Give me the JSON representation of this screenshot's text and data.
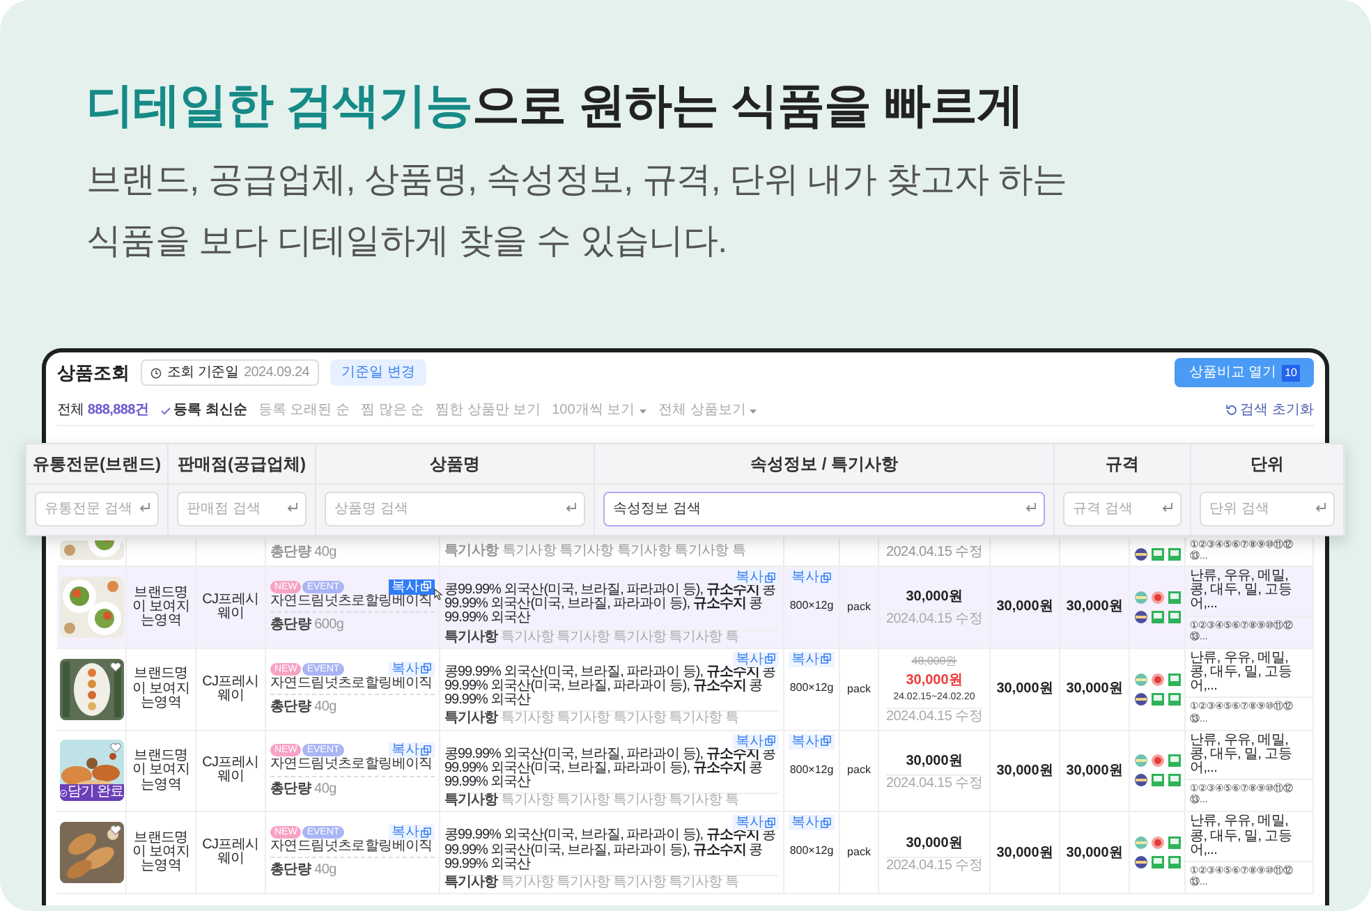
{
  "headline": {
    "highlight": "디테일한 검색기능",
    "rest": "으로 원하는 식품을 빠르게"
  },
  "subtitle": [
    "브랜드, 공급업체, 상품명, 속성정보, 규격, 단위 내가 찾고자 하는",
    "식품을 보다 디테일하게 찾을 수 있습니다."
  ],
  "app": {
    "title": "상품조회",
    "date_label": "조회 기준일",
    "date": "2024.09.24",
    "date_button": "기준일 변경",
    "compare_button": "상품비교 열기",
    "compare_count": "10",
    "total_label": "전체",
    "total": "888,888건",
    "sort_options": [
      {
        "label": "등록 최신순",
        "selected": true
      },
      {
        "label": "등록 오래된 순",
        "selected": false
      },
      {
        "label": "찜 많은 순",
        "selected": false
      },
      {
        "label": "찜한 상품만 보기",
        "selected": false
      }
    ],
    "dropdowns": [
      "100개씩 보기",
      "전체 상품보기"
    ],
    "reset": "검색 초기화"
  },
  "search_panel": [
    {
      "heading": "유통전문(브랜드)",
      "placeholder": "유통전문 검색",
      "focused": false
    },
    {
      "heading": "판매점(공급업체)",
      "placeholder": "판매점 검색",
      "focused": false
    },
    {
      "heading": "상품명",
      "placeholder": "상품명 검색",
      "focused": false
    },
    {
      "heading": "속성정보 / 특기사항",
      "value": "속성정보 검색",
      "focused": true
    },
    {
      "heading": "규격",
      "placeholder": "규격 검색",
      "focused": false
    },
    {
      "heading": "단위",
      "placeholder": "단위 검색",
      "focused": false
    }
  ],
  "partial_row": {
    "weight_label": "총단량",
    "weight": "40g",
    "notes_label": "특기사항",
    "notes": "특기사항 특기사항 특기사항 특기사항 특",
    "updated": "2024.04.15 수정",
    "allergen_codes": "①②③④⑤⑥⑦⑧⑨⑩⑪⑫⑬..."
  },
  "rows": [
    {
      "selected": true,
      "heart": false,
      "brand": "브랜드명이 보여지는영역",
      "seller": "CJ프레시웨이",
      "tags": [
        {
          "label": "NEW",
          "color": "#f7a3c4"
        },
        {
          "label": "EVENT",
          "color": "#a9b5f4"
        }
      ],
      "name": "자연드림넛츠로할링베이직",
      "name_copy": {
        "label": "복사",
        "active": true
      },
      "weight_label": "총단량",
      "weight": "600g",
      "attr_copy": {
        "label": "복사",
        "active": false
      },
      "attributes": "콩99.99% 외국산(미국, 브라질, 파라과이 등), **규소수지** 콩99.99% 외국산(미국, 브라질, 파라과이 등), **규소수지** 콩99.99% 외국산",
      "notes_label": "특기사항",
      "notes": "특기사항 특기사항 특기사항 특기사항 특",
      "spec_copy": {
        "label": "복사",
        "active": false
      },
      "spec": "800×12g",
      "unit": "pack",
      "price": "30,000원",
      "updated": "2024.04.15 수정",
      "price_2": "30,000원",
      "price_3": "30,000원",
      "allergens": "난류, 우유, 메밀, 콩, 대두, 밀, 고등어,...",
      "allergen_codes": "①②③④⑤⑥⑦⑧⑨⑩⑪⑫⑬..."
    },
    {
      "selected": false,
      "heart": true,
      "brand": "브랜드명이 보여지는영역",
      "seller": "CJ프레시웨이",
      "tags": [
        {
          "label": "NEW",
          "color": "#f7a3c4"
        },
        {
          "label": "EVENT",
          "color": "#a9b5f4"
        }
      ],
      "name": "자연드림넛츠로할링베이직",
      "name_copy": {
        "label": "복사",
        "active": false
      },
      "weight_label": "총단량",
      "weight": "40g",
      "attr_copy": {
        "label": "복사",
        "active": false
      },
      "attributes": "콩99.99% 외국산(미국, 브라질, 파라과이 등), **규소수지** 콩99.99% 외국산(미국, 브라질, 파라과이 등), **규소수지** 콩99.99% 외국산",
      "notes_label": "특기사항",
      "notes": "특기사항 특기사항 특기사항 특기사항 특",
      "spec_copy": {
        "label": "복사",
        "active": false
      },
      "spec": "800×12g",
      "unit": "pack",
      "original_price": "48,000원",
      "price": "30,000원",
      "sale_period": "24.02.15~24.02.20",
      "updated": "2024.04.15 수정",
      "price_2": "30,000원",
      "price_3": "30,000원",
      "allergens": "난류, 우유, 메밀, 콩, 대두, 밀, 고등어,...",
      "allergen_codes": "①②③④⑤⑥⑦⑧⑨⑩⑪⑫⑬..."
    },
    {
      "selected": false,
      "heart": true,
      "cart_label": "담기 완료",
      "brand": "브랜드명이 보여지는영역",
      "seller": "CJ프레시웨이",
      "tags": [
        {
          "label": "NEW",
          "color": "#f7a3c4"
        },
        {
          "label": "EVENT",
          "color": "#a9b5f4"
        }
      ],
      "name": "자연드림넛츠로할링베이직",
      "name_copy": {
        "label": "복사",
        "active": false
      },
      "weight_label": "총단량",
      "weight": "40g",
      "attr_copy": {
        "label": "복사",
        "active": false
      },
      "attributes": "콩99.99% 외국산(미국, 브라질, 파라과이 등), **규소수지** 콩99.99% 외국산(미국, 브라질, 파라과이 등), **규소수지** 콩99.99% 외국산",
      "notes_label": "특기사항",
      "notes": "특기사항 특기사항 특기사항 특기사항 특",
      "spec_copy": {
        "label": "복사",
        "active": false
      },
      "spec": "800×12g",
      "unit": "pack",
      "price": "30,000원",
      "updated": "2024.04.15 수정",
      "price_2": "30,000원",
      "price_3": "30,000원",
      "allergens": "난류, 우유, 메밀, 콩, 대두, 밀, 고등어,...",
      "allergen_codes": "①②③④⑤⑥⑦⑧⑨⑩⑪⑫⑬..."
    },
    {
      "selected": false,
      "heart": true,
      "brand": "브랜드명이 보여지는영역",
      "seller": "CJ프레시웨이",
      "tags": [
        {
          "label": "NEW",
          "color": "#f7a3c4"
        },
        {
          "label": "EVENT",
          "color": "#a9b5f4"
        }
      ],
      "name": "자연드림넛츠로할링베이직",
      "name_copy": {
        "label": "복사",
        "active": false
      },
      "weight_label": "총단량",
      "weight": "40g",
      "attr_copy": {
        "label": "복사",
        "active": false
      },
      "attributes": "콩99.99% 외국산(미국, 브라질, 파라과이 등), **규소수지** 콩99.99% 외국산(미국, 브라질, 파라과이 등), **규소수지** 콩99.99% 외국산",
      "notes_label": "특기사항",
      "notes": "특기사항 특기사항 특기사항 특기사항 특",
      "spec_copy": {
        "label": "복사",
        "active": false
      },
      "spec": "800×12g",
      "unit": "pack",
      "price": "30,000원",
      "updated": "2024.04.15 수정",
      "price_2": "30,000원",
      "price_3": "30,000원",
      "allergens": "난류, 우유, 메밀, 콩, 대두, 밀, 고등어,...",
      "allergen_codes": "①②③④⑤⑥⑦⑧⑨⑩⑪⑫⑬..."
    }
  ]
}
